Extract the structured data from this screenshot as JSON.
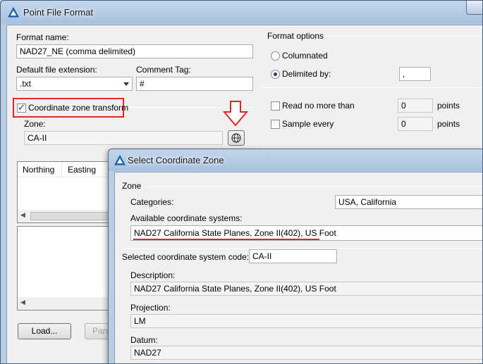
{
  "main_dialog": {
    "title": "Point File Format",
    "format_name_label": "Format name:",
    "format_name_value": "NAD27_NE (comma delimited)",
    "default_ext_label": "Default file extension:",
    "default_ext_value": ".txt",
    "comment_tag_label": "Comment Tag:",
    "comment_tag_value": "#",
    "coord_transform_label": "Coordinate zone transform",
    "coord_transform_checked": true,
    "zone_label": "Zone:",
    "zone_value": "CA-II",
    "format_options_label": "Format options",
    "columnated_label": "Columnated",
    "delimited_label": "Delimited by:",
    "delimiter_value": ",",
    "read_no_more_label": "Read no more than",
    "read_no_more_value": "0",
    "points_label": "points",
    "sample_every_label": "Sample every",
    "sample_every_value": "0",
    "points_label_2": "points",
    "table_columns": [
      "Northing",
      "Easting"
    ],
    "load_button": "Load...",
    "parse_button": "Pars"
  },
  "zone_dialog": {
    "title": "Select Coordinate Zone",
    "zone_group_label": "Zone",
    "categories_label": "Categories:",
    "categories_value": "USA, California",
    "available_label": "Available coordinate systems:",
    "available_value": "NAD27 California State Planes, Zone II(402), US Foot",
    "selected_code_label": "Selected coordinate system code:",
    "selected_code_value": "CA-II",
    "description_label": "Description:",
    "description_value": "NAD27 California State Planes, Zone II(402), US Foot",
    "projection_label": "Projection:",
    "projection_value": "LM",
    "datum_label": "Datum:",
    "datum_value": "NAD27"
  },
  "colors": {
    "highlight_red": "#e4222a",
    "title_blue": "#a9c1de"
  }
}
